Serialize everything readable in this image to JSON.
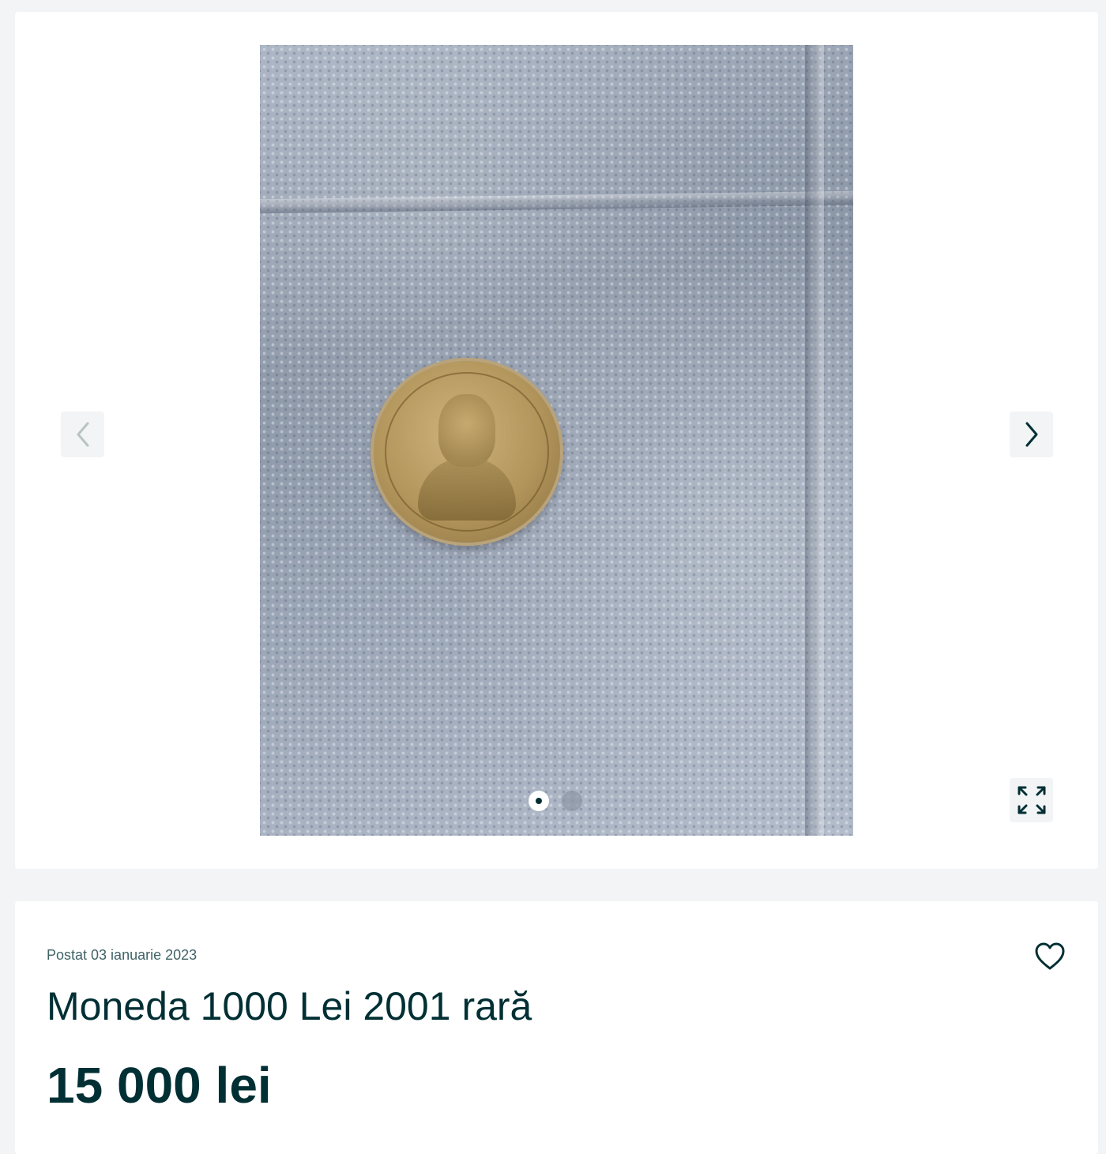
{
  "gallery": {
    "photo_alt": "",
    "prev_icon": "chevron-left-icon",
    "next_icon": "chevron-right-icon",
    "expand_icon": "expand-icon",
    "slide_count": 2,
    "active_slide": 1
  },
  "ad": {
    "posted": "Postat 03 ianuarie 2023",
    "title": "Moneda 1000 Lei 2001 rară",
    "price": "15 000 lei",
    "favorite_icon": "heart-icon"
  },
  "colors": {
    "background": "#f2f4f5",
    "card": "#ffffff",
    "text": "#002f34",
    "muted": "#406367"
  }
}
